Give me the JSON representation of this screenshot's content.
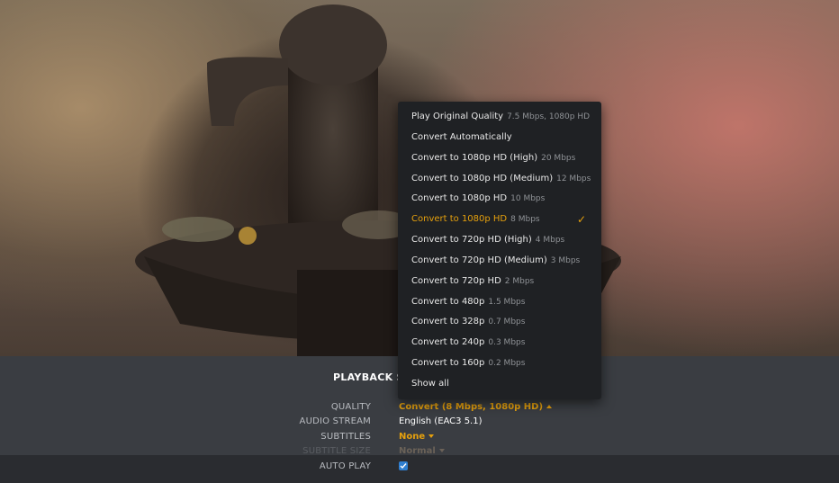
{
  "panel": {
    "title": "PLAYBACK SE",
    "rows": [
      {
        "label": "QUALITY",
        "value": "Convert (8 Mbps, 1080p HD)"
      },
      {
        "label": "AUDIO STREAM",
        "value": "English (EAC3 5.1)"
      },
      {
        "label": "SUBTITLES",
        "value": "None"
      },
      {
        "label": "SUBTITLE SIZE",
        "value": "Normal"
      },
      {
        "label": "AUTO PLAY",
        "checked": true
      }
    ]
  },
  "quality_menu": {
    "items": [
      {
        "label": "Play Original Quality",
        "detail": "7.5 Mbps, 1080p HD"
      },
      {
        "label": "Convert Automatically",
        "detail": ""
      },
      {
        "label": "Convert to 1080p HD (High)",
        "detail": "20 Mbps"
      },
      {
        "label": "Convert to 1080p HD (Medium)",
        "detail": "12 Mbps"
      },
      {
        "label": "Convert to 1080p HD",
        "detail": "10 Mbps"
      },
      {
        "label": "Convert to 1080p HD",
        "detail": "8 Mbps",
        "selected": true,
        "check": "✓"
      },
      {
        "label": "Convert to 720p HD (High)",
        "detail": "4 Mbps"
      },
      {
        "label": "Convert to 720p HD (Medium)",
        "detail": "3 Mbps"
      },
      {
        "label": "Convert to 720p HD",
        "detail": "2 Mbps"
      },
      {
        "label": "Convert to 480p",
        "detail": "1.5 Mbps"
      },
      {
        "label": "Convert to 328p",
        "detail": "0.7 Mbps"
      },
      {
        "label": "Convert to 240p",
        "detail": "0.3 Mbps"
      },
      {
        "label": "Convert to 160p",
        "detail": "0.2 Mbps"
      },
      {
        "label": "Show all",
        "detail": ""
      }
    ]
  },
  "colors": {
    "accent": "#e5a00d",
    "menu_bg": "#1f2124",
    "panel_bg": "#3a3d42",
    "checkbox": "#2f7fd0"
  }
}
